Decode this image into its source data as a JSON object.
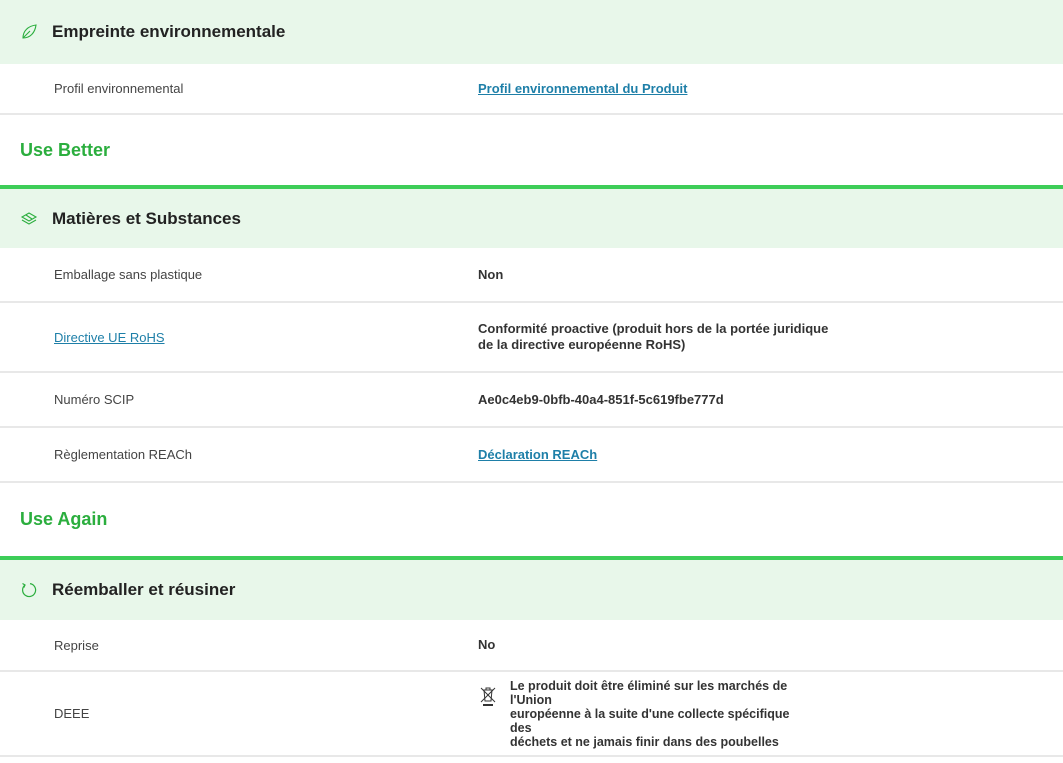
{
  "sections": {
    "footprint": {
      "icon": "leaf-icon",
      "title": "Empreinte environnementale",
      "rows": [
        {
          "label": "Profil environnemental",
          "value": "Profil environnemental du Produit"
        }
      ]
    },
    "use_better": {
      "group_title": "Use Better",
      "icon": "layers-icon",
      "title": "Matières et Substances",
      "rows": [
        {
          "label": "Emballage sans plastique",
          "value": "Non"
        },
        {
          "label": "Directive UE RoHS",
          "value_line1": "Conformité proactive (produit hors de la portée juridique",
          "value_line2": "de la directive européenne RoHS)"
        },
        {
          "label": "Numéro SCIP",
          "value": "Ae0c4eb9-0bfb-40a4-851f-5c619fbe777d"
        },
        {
          "label": "Règlementation REACh",
          "value": "Déclaration REACh"
        }
      ]
    },
    "use_again": {
      "group_title": "Use Again",
      "icon": "refresh-icon",
      "title": "Réemballer et réusiner",
      "rows": [
        {
          "label": "Reprise",
          "value": "No"
        },
        {
          "label": "DEEE",
          "value_line1": "Le produit doit être éliminé sur les marchés de l'Union",
          "value_line2": "européenne à la suite d'une collecte spécifique des",
          "value_line3": "déchets et ne jamais finir dans des poubelles",
          "icon": "crossed-bin-icon"
        }
      ]
    }
  },
  "colors": {
    "accent_green": "#3dcd58",
    "header_bg": "#e8f7ea",
    "group_title": "#2bae3e",
    "link": "#1e7fa8"
  }
}
